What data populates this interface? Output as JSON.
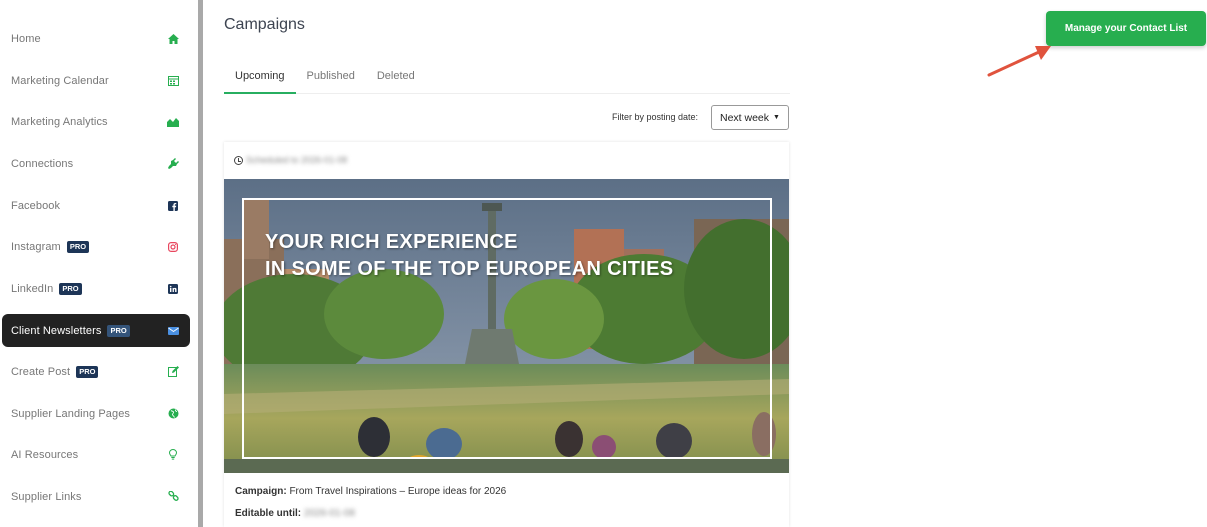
{
  "sidebar": {
    "items": [
      {
        "label": "Home",
        "icon": "home-icon",
        "pro": false,
        "active": false
      },
      {
        "label": "Marketing Calendar",
        "icon": "calendar-icon",
        "pro": false,
        "active": false
      },
      {
        "label": "Marketing Analytics",
        "icon": "area-chart-icon",
        "pro": false,
        "active": false
      },
      {
        "label": "Connections",
        "icon": "plug-icon",
        "pro": false,
        "active": false
      },
      {
        "label": "Facebook",
        "icon": "facebook-icon",
        "pro": false,
        "active": false
      },
      {
        "label": "Instagram",
        "icon": "instagram-icon",
        "pro": true,
        "active": false
      },
      {
        "label": "LinkedIn",
        "icon": "linkedin-icon",
        "pro": true,
        "active": false
      },
      {
        "label": "Client Newsletters",
        "icon": "envelope-icon",
        "pro": true,
        "active": true
      },
      {
        "label": "Create Post",
        "icon": "edit-icon",
        "pro": true,
        "active": false
      },
      {
        "label": "Supplier Landing Pages",
        "icon": "globe-icon",
        "pro": false,
        "active": false
      },
      {
        "label": "AI Resources",
        "icon": "lightbulb-icon",
        "pro": false,
        "active": false
      },
      {
        "label": "Supplier Links",
        "icon": "link-icon",
        "pro": false,
        "active": false
      }
    ],
    "pro_badge": "PRO"
  },
  "page": {
    "title": "Campaigns",
    "tabs": [
      "Upcoming",
      "Published",
      "Deleted"
    ],
    "active_tab": "Upcoming"
  },
  "filter": {
    "label": "Filter by posting date:",
    "selected": "Next week"
  },
  "card": {
    "scheduled_text": "Scheduled to 2026-01-08",
    "image_title_line1": "YOUR RICH EXPERIENCE",
    "image_title_line2": "IN SOME OF THE TOP EUROPEAN CITIES",
    "campaign_label": "Campaign:",
    "campaign_value": "From Travel Inspirations – Europe ideas for 2026",
    "editable_label": "Editable until:",
    "editable_value": "2026-01-08"
  },
  "header": {
    "contact_button": "Manage your Contact List"
  },
  "colors": {
    "accent_green": "#27ae4f",
    "pro_badge": "#1d3557",
    "active_nav": "#222222",
    "arrow": "#e0533d"
  }
}
